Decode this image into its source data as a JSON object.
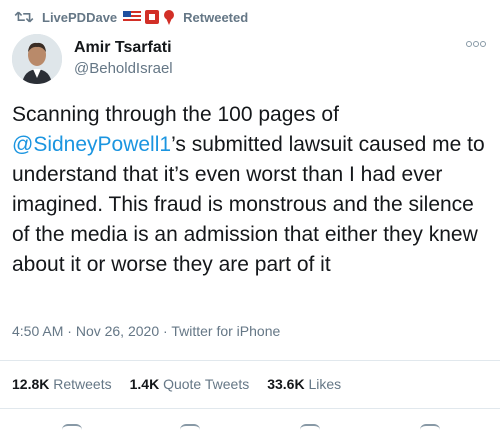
{
  "retweet": {
    "user": "LivePDDave",
    "label": "Retweeted"
  },
  "author": {
    "display_name": "Amir Tsarfati",
    "handle": "@BeholdIsrael"
  },
  "tweet": {
    "text_before": "Scanning through the 100 pages of ",
    "mention": "@SidneyPowell1",
    "text_after": "’s submitted lawsuit caused me to understand that it’s even worst than I had ever imagined. This fraud is monstrous and the silence of the media is an admission that either they knew about it or worse they are part of it"
  },
  "meta": {
    "time": "4:50 AM",
    "sep1": " · ",
    "date": "Nov 26, 2020",
    "sep2": " · ",
    "source": "Twitter for iPhone"
  },
  "stats": {
    "retweets_count": "12.8K",
    "retweets_label": "Retweets",
    "quotes_count": "1.4K",
    "quotes_label": "Quote Tweets",
    "likes_count": "33.6K",
    "likes_label": "Likes"
  },
  "colors": {
    "link": "#1b95e0",
    "secondary": "#657786",
    "primary": "#14171a"
  },
  "icons": {
    "retweet": "retweet-icon",
    "flag": "us-flag-icon",
    "badge": "red-square-icon",
    "pin": "red-pin-icon",
    "more": "more-options-icon"
  }
}
